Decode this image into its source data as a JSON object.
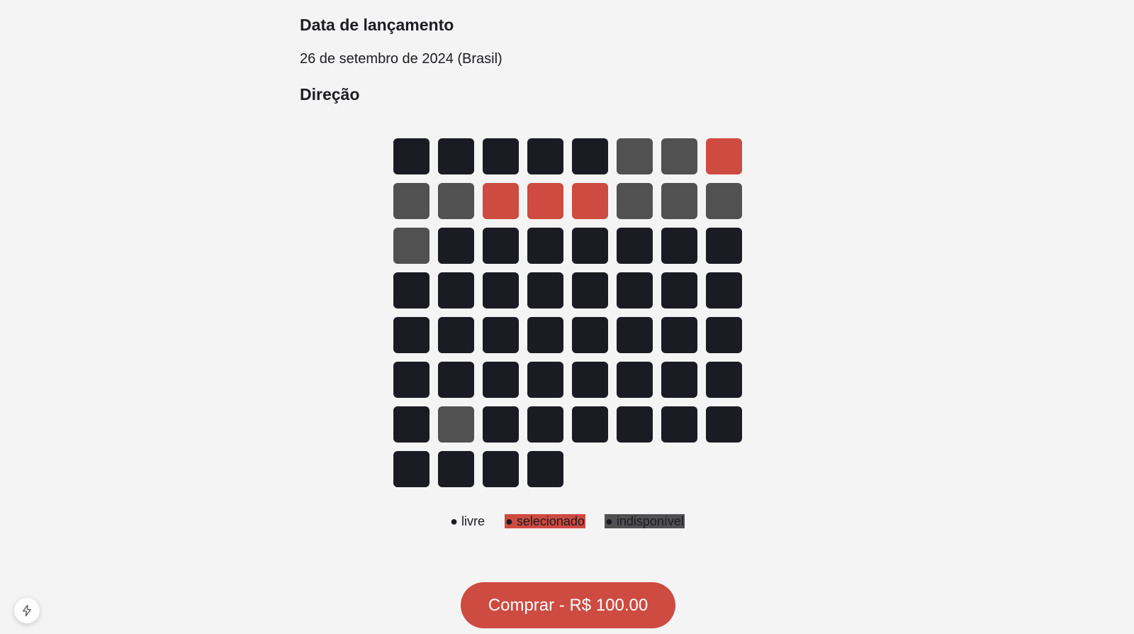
{
  "release": {
    "heading": "Data de lançamento",
    "date": "26 de setembro de 2024 (Brasil)"
  },
  "direction": {
    "heading": "Direção"
  },
  "seat_map": {
    "columns": 8,
    "seats": [
      "livre",
      "livre",
      "livre",
      "livre",
      "livre",
      "indisponivel",
      "indisponivel",
      "selecionado",
      "indisponivel",
      "indisponivel",
      "selecionado",
      "selecionado",
      "selecionado",
      "indisponivel",
      "indisponivel",
      "indisponivel",
      "indisponivel",
      "livre",
      "livre",
      "livre",
      "livre",
      "livre",
      "livre",
      "livre",
      "livre",
      "livre",
      "livre",
      "livre",
      "livre",
      "livre",
      "livre",
      "livre",
      "livre",
      "livre",
      "livre",
      "livre",
      "livre",
      "livre",
      "livre",
      "livre",
      "livre",
      "livre",
      "livre",
      "livre",
      "livre",
      "livre",
      "livre",
      "livre",
      "livre",
      "indisponivel",
      "livre",
      "livre",
      "livre",
      "livre",
      "livre",
      "livre",
      "livre",
      "livre",
      "livre",
      "livre"
    ],
    "colors": {
      "livre": "#1b1b23",
      "selecionado": "#cd4b41",
      "indisponivel": "#515151"
    }
  },
  "legend": {
    "free": "● livre",
    "selected": "● selecionado",
    "unavailable": "● indisponível"
  },
  "buy_button": {
    "label": "Comprar - R$ 100.00"
  },
  "floating_button": {
    "icon": "lightning-icon"
  }
}
